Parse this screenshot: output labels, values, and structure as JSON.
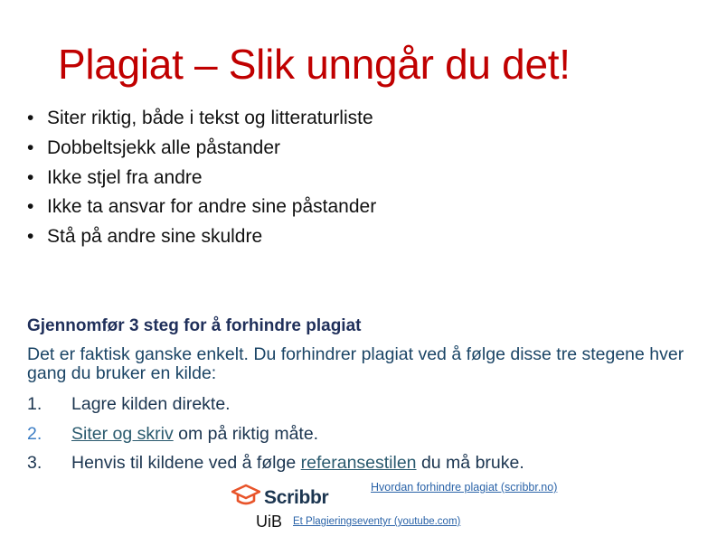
{
  "slide": {
    "title": "Plagiat – Slik unngår du det!",
    "bullets": [
      "Siter riktig, både i tekst og litteraturliste",
      "Dobbeltsjekk alle påstander",
      "Ikke stjel fra andre",
      "Ikke ta ansvar for andre sine påstander",
      "Stå på andre sine skuldre"
    ],
    "bullet_symbol": "•",
    "steps_heading": "Gjennomfør 3 steg for å forhindre plagiat",
    "steps_intro": "Det er faktisk ganske enkelt. Du forhindrer plagiat ved å følge disse tre stegene hver gang du bruker en kilde:",
    "steps": [
      {
        "num": "1.",
        "before": "Lagre kilden direkte.",
        "link": "",
        "after": ""
      },
      {
        "num": "2.",
        "before": "",
        "link": "Siter og skriv",
        "after": " om på riktig måte."
      },
      {
        "num": "3.",
        "before": "Henvis til kildene ved å følge ",
        "link": "referansestilen",
        "after": " du må bruke."
      }
    ],
    "scribbr_logo_text": "Scribbr",
    "scribbr_link": "Hvordan forhindre plagiat (scribbr.no)",
    "uib_logo_text": "UiB",
    "youtube_link": "Et Plagieringseventyr (youtube.com)",
    "colors": {
      "title": "#c00000",
      "heading": "#1f2f5a",
      "body_blue": "#1b4566",
      "scribbr_orange": "#e8542a",
      "link": "#2a63a8"
    },
    "icons": {
      "scribbr_logo": "graduation-cap-icon"
    }
  }
}
